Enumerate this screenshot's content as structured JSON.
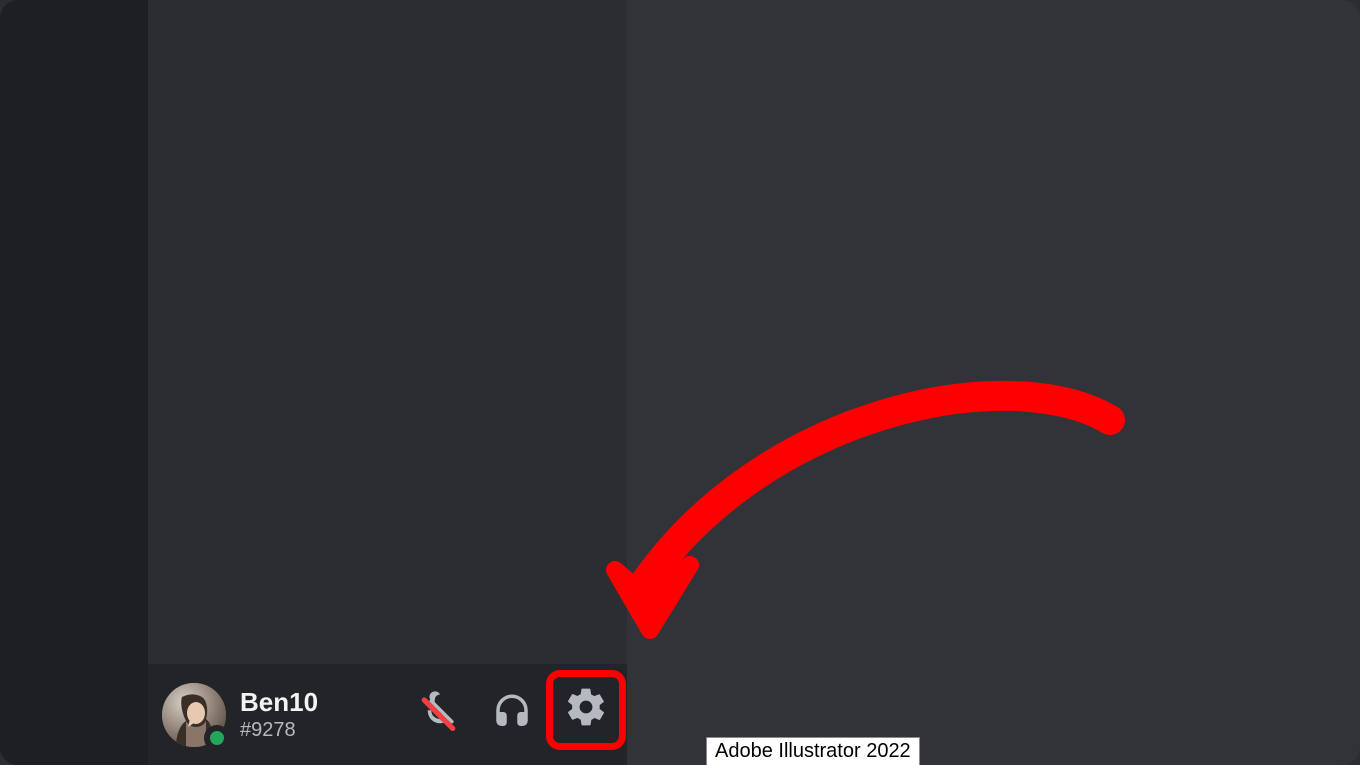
{
  "user": {
    "name": "Ben10",
    "discriminator": "#9278",
    "status": "online"
  },
  "controls": {
    "mic": {
      "semantic": "microphone-muted-icon"
    },
    "headphones": {
      "semantic": "headphones-icon"
    },
    "settings": {
      "semantic": "gear-icon"
    }
  },
  "tooltip": {
    "text": "Adobe Illustrator 2022"
  },
  "annotation": {
    "arrow_color": "#ff0000",
    "highlight_color": "#ff0000"
  }
}
